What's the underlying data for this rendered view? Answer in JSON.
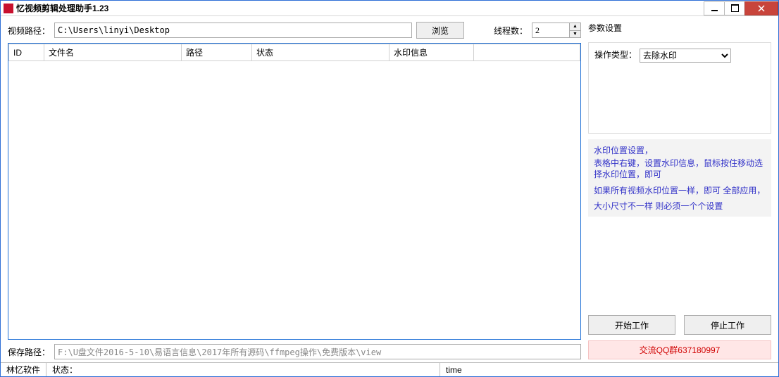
{
  "window": {
    "title": "忆视频剪辑处理助手1.23"
  },
  "top": {
    "video_path_label": "视频路径：",
    "video_path_value": "C:\\Users\\linyi\\Desktop",
    "browse_label": "浏览",
    "thread_label": "线程数：",
    "thread_value": "2"
  },
  "table": {
    "headers": [
      "ID",
      "文件名",
      "路径",
      "状态",
      "水印信息",
      ""
    ]
  },
  "right": {
    "params_title": "参数设置",
    "op_type_label": "操作类型：",
    "op_type_value": "去除水印",
    "hints": [
      "水印位置设置，",
      "表格中右键，设置水印信息，鼠标按住移动选择水印位置，即可",
      "如果所有视频水印位置一样，即可 全部应用，",
      "大小尺寸不一样 则必须一个个设置"
    ],
    "start_label": "开始工作",
    "stop_label": "停止工作",
    "qq_label": "交流QQ群637180997"
  },
  "bottom": {
    "save_path_label": "保存路径：",
    "save_path_value": "F:\\U盘文件2016-5-10\\易语言信息\\2017年所有源码\\ffmpeg操作\\免费版本\\view"
  },
  "status": {
    "brand": "林忆软件",
    "state_label": "状态：",
    "time_label": "time"
  }
}
